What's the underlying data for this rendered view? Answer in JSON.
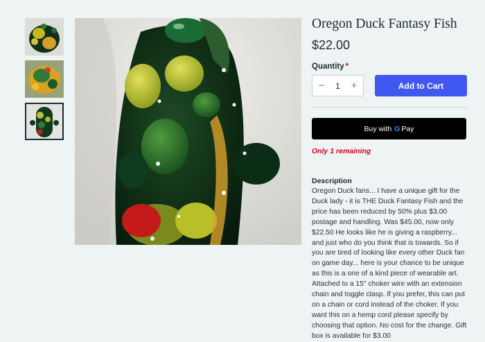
{
  "product": {
    "title": "Oregon Duck Fantasy Fish",
    "price": "$22.00"
  },
  "quantity": {
    "label": "Quantity",
    "required_mark": "*",
    "value": "1",
    "decrement": "−",
    "increment": "+"
  },
  "actions": {
    "add_to_cart": "Add to Cart",
    "buy_with": "Buy with",
    "pay_brand": "Pay"
  },
  "stock": {
    "remaining": "Only 1 remaining"
  },
  "description": {
    "heading": "Description",
    "text": "Oregon Duck fans... I have a unique gift for the Duck lady - it is THE Duck Fantasy Fish and the price has been reduced by 50% plus $3.00 postage and handling. Was $45.00, now only $22.50 He looks like he is giving a raspberry... and just who do you think that is towards. So if you are tired of looking like every other Duck fan on game day... here is your chance to be unique as this is a one of a kind piece of wearable art. Attached to a 15\" choker wire with an extension chain and toggle clasp. If you prefer, this can put on a chain or cord instead of the choker. If you want this on a hemp cord please specify by choosing that option. No cost for the change. Gift box is available for $3.00"
  },
  "gallery": {
    "thumbnails": [
      "thumbnail-1",
      "thumbnail-2",
      "thumbnail-3"
    ],
    "selected_index": 3
  },
  "colors": {
    "accent": "#4057f0",
    "alert": "#d0021b",
    "background": "#eef4f4"
  }
}
